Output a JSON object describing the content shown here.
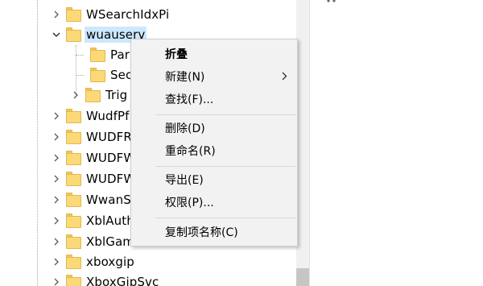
{
  "tree": {
    "items": [
      {
        "label": "WSearchIdxPi",
        "expander": "collapsed"
      },
      {
        "label": "wuauserv",
        "expander": "expanded",
        "selected": true
      },
      {
        "label": "Para",
        "expander": "none"
      },
      {
        "label": "Secu",
        "expander": "none"
      },
      {
        "label": "Trig",
        "expander": "collapsed"
      },
      {
        "label": "WudfPf",
        "expander": "collapsed"
      },
      {
        "label": "WUDFR",
        "expander": "collapsed"
      },
      {
        "label": "WUDFW",
        "expander": "collapsed"
      },
      {
        "label": "WUDFW",
        "expander": "collapsed"
      },
      {
        "label": "WwanS",
        "expander": "collapsed"
      },
      {
        "label": "XblAuth",
        "expander": "collapsed"
      },
      {
        "label": "XblGam",
        "expander": "collapsed"
      },
      {
        "label": "xboxgip",
        "expander": "collapsed"
      },
      {
        "label": "XboxGipSvc",
        "expander": "collapsed"
      }
    ]
  },
  "context_menu": {
    "items": [
      {
        "label": "折叠",
        "bold": true
      },
      {
        "label": "新建(N)",
        "submenu": true
      },
      {
        "label": "查找(F)..."
      },
      {
        "separator": true
      },
      {
        "label": "删除(D)"
      },
      {
        "label": "重命名(R)"
      },
      {
        "separator": true
      },
      {
        "label": "导出(E)"
      },
      {
        "label": "权限(P)..."
      },
      {
        "separator": true
      },
      {
        "label": "复制项名称(C)"
      }
    ]
  },
  "colors": {
    "selection": "#cce8ff",
    "folder": "#fbd977",
    "menu_bg": "#f2f2f2"
  }
}
